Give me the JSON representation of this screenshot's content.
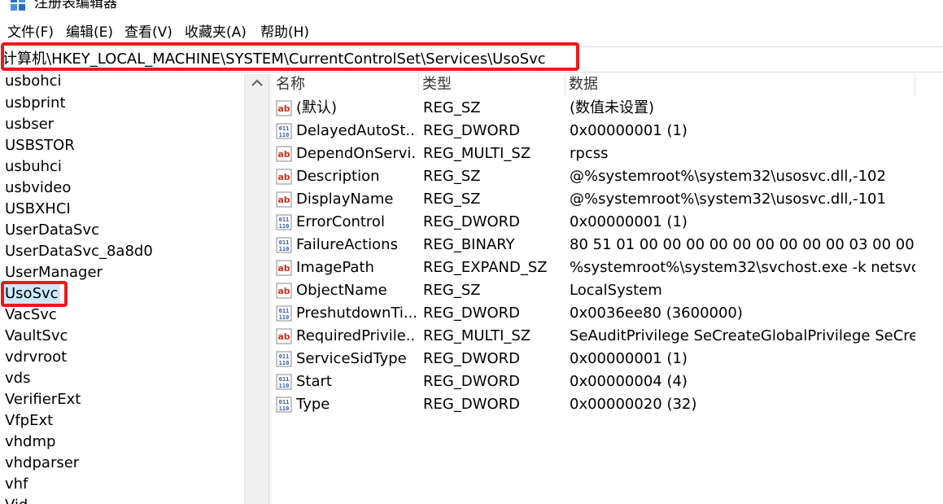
{
  "window": {
    "title": "注册表编辑器",
    "icon": "registry-editor-icon"
  },
  "menu": [
    "文件(F)",
    "编辑(E)",
    "查看(V)",
    "收藏夹(A)",
    "帮助(H)"
  ],
  "address": {
    "path": "计算机\\HKEY_LOCAL_MACHINE\\SYSTEM\\CurrentControlSet\\Services\\UsoSvc"
  },
  "tree": {
    "selected": "UsoSvc",
    "items": [
      "usbohci",
      "usbprint",
      "usbser",
      "USBSTOR",
      "usbuhci",
      "usbvideo",
      "USBXHCI",
      "UserDataSvc",
      "UserDataSvc_8a8d0",
      "UserManager",
      "UsoSvc",
      "VacSvc",
      "VaultSvc",
      "vdrvroot",
      "vds",
      "VerifierExt",
      "VfpExt",
      "vhdmp",
      "vhdparser",
      "vhf",
      "Vid"
    ]
  },
  "columns": {
    "name": "名称",
    "type": "类型",
    "data": "数据"
  },
  "values": [
    {
      "icon": "string-value-icon",
      "name": "(默认)",
      "type": "REG_SZ",
      "data": "(数值未设置)"
    },
    {
      "icon": "binary-value-icon",
      "name": "DelayedAutoSt...",
      "type": "REG_DWORD",
      "data": "0x00000001 (1)"
    },
    {
      "icon": "string-value-icon",
      "name": "DependOnServi...",
      "type": "REG_MULTI_SZ",
      "data": "rpcss"
    },
    {
      "icon": "string-value-icon",
      "name": "Description",
      "type": "REG_SZ",
      "data": "@%systemroot%\\system32\\usosvc.dll,-102"
    },
    {
      "icon": "string-value-icon",
      "name": "DisplayName",
      "type": "REG_SZ",
      "data": "@%systemroot%\\system32\\usosvc.dll,-101"
    },
    {
      "icon": "binary-value-icon",
      "name": "ErrorControl",
      "type": "REG_DWORD",
      "data": "0x00000001 (1)"
    },
    {
      "icon": "binary-value-icon",
      "name": "FailureActions",
      "type": "REG_BINARY",
      "data": "80 51 01 00 00 00 00 00 00 00 00 00 03 00 00 ..."
    },
    {
      "icon": "string-value-icon",
      "name": "ImagePath",
      "type": "REG_EXPAND_SZ",
      "data": "%systemroot%\\system32\\svchost.exe -k netsvc..."
    },
    {
      "icon": "string-value-icon",
      "name": "ObjectName",
      "type": "REG_SZ",
      "data": "LocalSystem"
    },
    {
      "icon": "binary-value-icon",
      "name": "PreshutdownTi...",
      "type": "REG_DWORD",
      "data": "0x0036ee80 (3600000)"
    },
    {
      "icon": "string-value-icon",
      "name": "RequiredPrivile...",
      "type": "REG_MULTI_SZ",
      "data": "SeAuditPrivilege SeCreateGlobalPrivilege SeCre..."
    },
    {
      "icon": "binary-value-icon",
      "name": "ServiceSidType",
      "type": "REG_DWORD",
      "data": "0x00000001 (1)"
    },
    {
      "icon": "binary-value-icon",
      "name": "Start",
      "type": "REG_DWORD",
      "data": "0x00000004 (4)"
    },
    {
      "icon": "binary-value-icon",
      "name": "Type",
      "type": "REG_DWORD",
      "data": "0x00000020 (32)"
    }
  ],
  "colors": {
    "highlight": "#e8191f",
    "selection": "#cce8ff",
    "string_icon": "#c8331f",
    "binary_icon": "#2e5aa8"
  }
}
